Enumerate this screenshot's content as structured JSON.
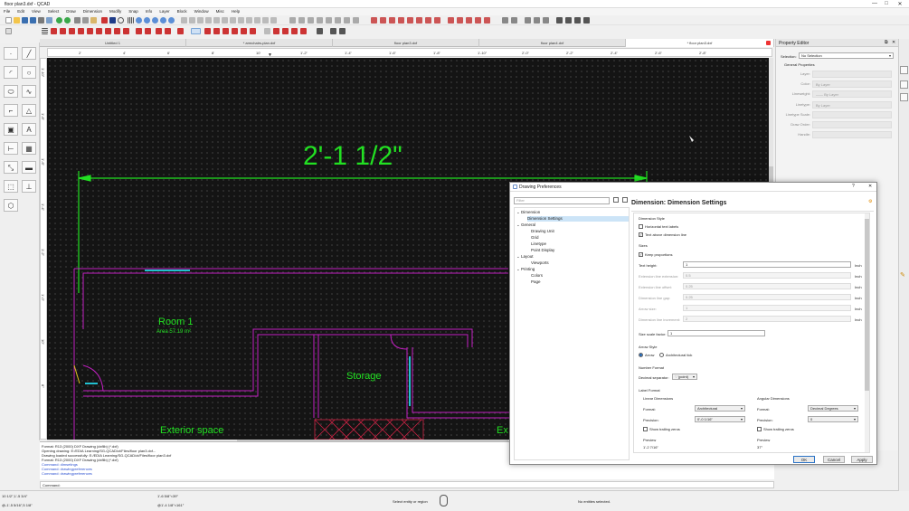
{
  "window": {
    "title": "floor plan3.dxf - QCAD",
    "min": "—",
    "max": "□",
    "close": "✕"
  },
  "menu": [
    "File",
    "Edit",
    "View",
    "Select",
    "Draw",
    "Dimension",
    "Modify",
    "Snap",
    "Info",
    "Layer",
    "Block",
    "Window",
    "Misc",
    "Help"
  ],
  "tabs": [
    {
      "label": "Untitled 1",
      "active": false
    },
    {
      "label": "* armchairs-plan.dxf",
      "active": false
    },
    {
      "label": "floor plan3.dxf",
      "active": false
    },
    {
      "label": "floor plan4.dxf",
      "active": false
    },
    {
      "label": "* floor plan3.dxf",
      "active": true
    }
  ],
  "ruler": {
    "top": [
      "2'",
      "4'",
      "6'",
      "8'",
      "10'",
      "1'-2\"",
      "1'-4\"",
      "1'-6\"",
      "1'-8\"",
      "1'-10\"",
      "2'-0\"",
      "2'-2\"",
      "2'-4\"",
      "2'-6\"",
      "2'-8\""
    ],
    "left": [
      "1'-10\"",
      "1'-8\"",
      "1'-6\"",
      "1'-4\"",
      "1'-2\"",
      "1'-0\"",
      "10\"",
      "8\""
    ]
  },
  "drawing": {
    "dimension": "2'-1 1/2\"",
    "room1": "Room 1",
    "room1_area": "Area 57.19 m²",
    "storage": "Storage",
    "exterior": "Exterior space",
    "exterior2": "Ex"
  },
  "cmd": {
    "history": [
      "Format: R13 (2000) DXF Drawing (dxflib) (*.dxf)",
      "Opening drawing: E:/EDIA Learning/SG-QCAD/ct/Files/floor plan3.dxf...",
      "Drawing loaded successfully: E:/EDIA Learning/SG-QCAD/ct/Files/floor plan3.dxf",
      "Format: R13 (2000) DXF Drawing (dxflib) (*.dxf)",
      "Command: dimsetings",
      "Command: drawingpreferences",
      "Command: drawingpreferences"
    ],
    "prompt": "Command:"
  },
  "status": {
    "coord1": "10 1/2\",1'-5 3/4\"",
    "coord2": "@-1'-5 5/16\",5 1/8\"",
    "coord3": "1'-6 5/8\"<39°",
    "coord4": "@1'-4 1/8\"<161°",
    "hint": "Select entity or region",
    "selection": "No entities selected."
  },
  "property_editor": {
    "title": "Property Editor",
    "selection_label": "Selection:",
    "selection_value": "No Selection",
    "section": "General Properties",
    "rows": [
      {
        "label": "Layer:",
        "value": ""
      },
      {
        "label": "Color:",
        "value": "By Layer"
      },
      {
        "label": "Lineweight:",
        "value": "—— By Layer"
      },
      {
        "label": "Linetype:",
        "value": "By Layer"
      },
      {
        "label": "Linetype Scale:",
        "value": ""
      },
      {
        "label": "Draw Order:",
        "value": ""
      },
      {
        "label": "Handle:",
        "value": ""
      }
    ]
  },
  "dialog": {
    "title": "Drawing Preferences",
    "help": "?",
    "close": "✕",
    "filter_placeholder": "Filter",
    "tree": [
      {
        "label": "Dimension",
        "level": 0,
        "arrow": "⌄"
      },
      {
        "label": "Dimension Settings",
        "level": 1,
        "selected": true
      },
      {
        "label": "General",
        "level": 0,
        "arrow": "⌄"
      },
      {
        "label": "Drawing Unit",
        "level": 1
      },
      {
        "label": "Grid",
        "level": 1
      },
      {
        "label": "Linetype",
        "level": 1
      },
      {
        "label": "Point Display",
        "level": 1
      },
      {
        "label": "Layout",
        "level": 0,
        "arrow": "⌄"
      },
      {
        "label": "Viewports",
        "level": 1
      },
      {
        "label": "Printing",
        "level": 0,
        "arrow": "⌄"
      },
      {
        "label": "Colors",
        "level": 1
      },
      {
        "label": "Page",
        "level": 1
      }
    ],
    "heading": "Dimension: Dimension Settings",
    "style_group": "Dimension Style",
    "horiz_labels": "Horizontal text labels",
    "text_above": "Text above dimension line",
    "sizes_group": "Sizes",
    "keep_prop": "Keep proportions",
    "sizes": [
      {
        "label": "Text height:",
        "value": "1",
        "unit": "Inch",
        "enabled": true
      },
      {
        "label": "Extension line extension:",
        "value": "0.5",
        "unit": "Inch",
        "enabled": false
      },
      {
        "label": "Extension line offset:",
        "value": "0.25",
        "unit": "Inch",
        "enabled": false
      },
      {
        "label": "Dimension line gap:",
        "value": "0.25",
        "unit": "Inch",
        "enabled": false
      },
      {
        "label": "Arrow size:",
        "value": "1",
        "unit": "Inch",
        "enabled": false
      },
      {
        "label": "Dimension line increment:",
        "value": "2",
        "unit": "Inch",
        "enabled": false
      }
    ],
    "scale_label": "Size scale factor:",
    "scale_value": "1",
    "arrow_group": "Arrow Style",
    "arrow": "Arrow",
    "arch_tick": "Architectural tick",
    "number_group": "Number Format",
    "decimal_label": "Decimal separator:",
    "decimal_value": "'.' (point)",
    "label_group": "Label Format",
    "linear": {
      "title": "Linear Dimensions",
      "format_label": "Format:",
      "format": "Architectural",
      "precision_label": "Precision:",
      "precision": "0'-0 1/16\"",
      "trailing": "Show trailing zeros",
      "preview_label": "Preview",
      "preview": "1'-2 7/16\""
    },
    "angular": {
      "title": "Angular Dimensions",
      "format_label": "Format:",
      "format": "Decimal Degrees",
      "precision_label": "Precision:",
      "precision": "0",
      "trailing": "Show trailing zeros",
      "preview_label": "Preview",
      "preview": "37°"
    },
    "ok": "OK",
    "cancel": "Cancel",
    "apply": "Apply"
  }
}
